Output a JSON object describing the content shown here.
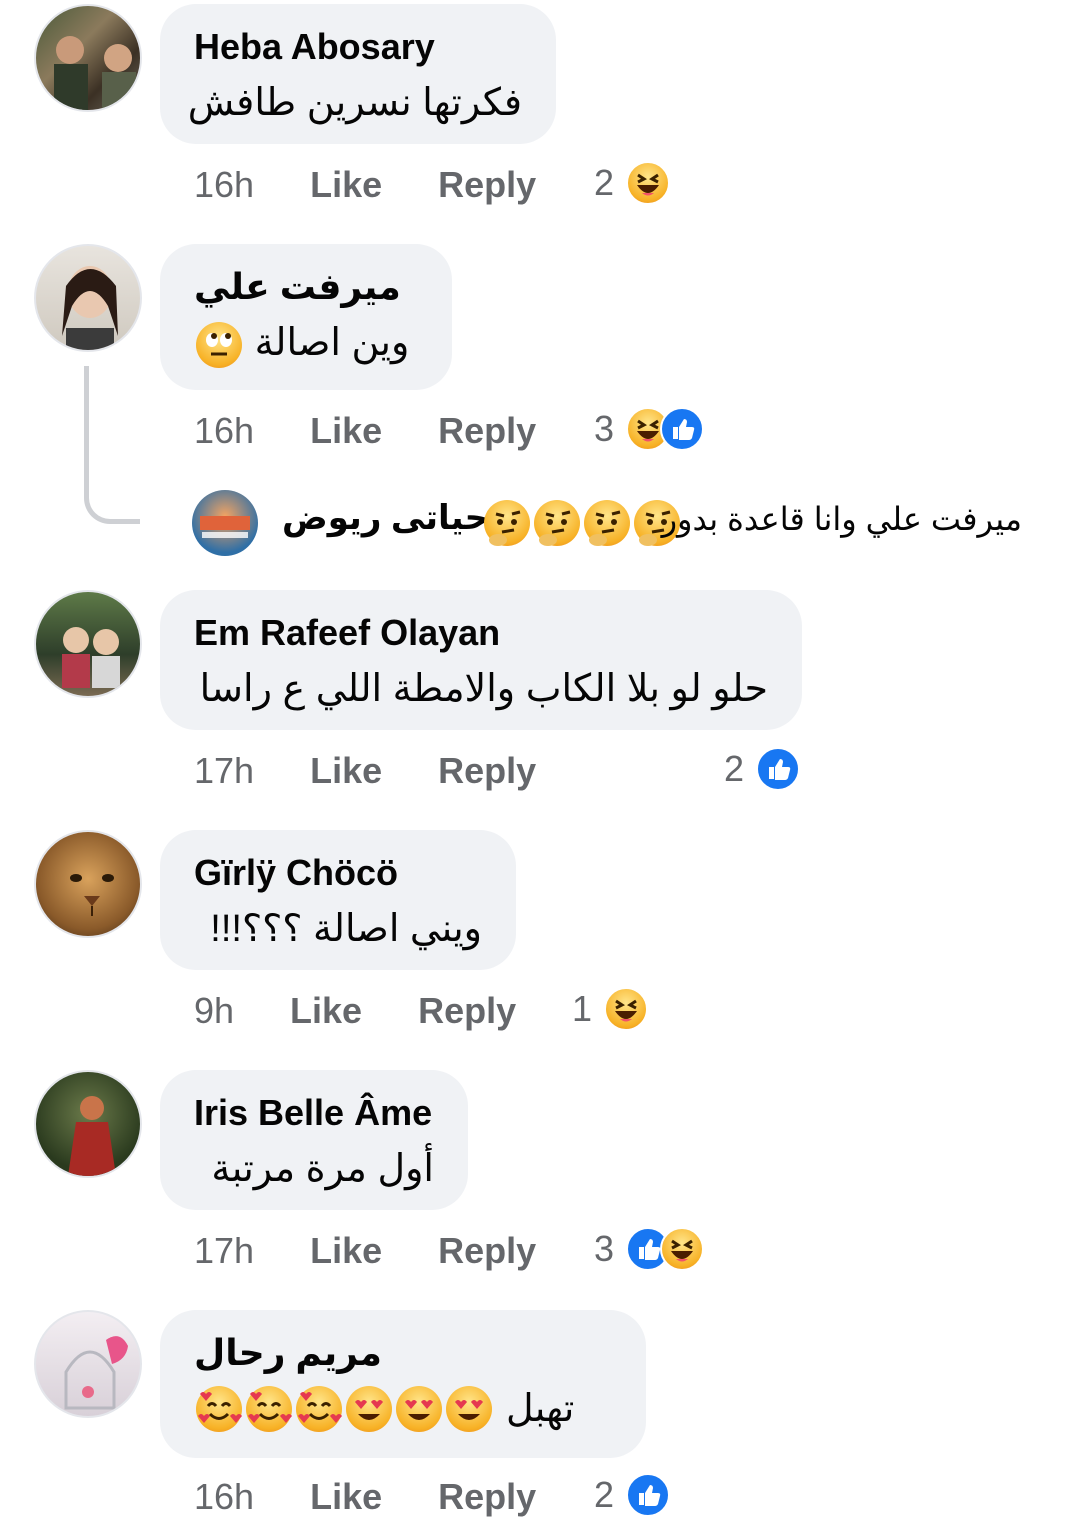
{
  "labels": {
    "like": "Like",
    "reply": "Reply"
  },
  "comments": [
    {
      "author": "Heba Abosary",
      "text": "فكرتها نسرين طافش",
      "time": "16h",
      "reaction_count": "2",
      "reactions": [
        "haha-icon"
      ]
    },
    {
      "author": "ميرفت علي",
      "text": "وين اصالة",
      "text_emoji": "rolling-eyes-emoji",
      "time": "16h",
      "reaction_count": "3",
      "reactions": [
        "haha-icon",
        "like-icon"
      ],
      "reply_preview": {
        "author": "حياتى ريوض",
        "text": "ميرفت علي وانا قاعدة بدور",
        "emoji": [
          "thinking-emoji",
          "thinking-emoji",
          "thinking-emoji",
          "thinking-emoji"
        ]
      }
    },
    {
      "author": "Em Rafeef Olayan",
      "text": "حلو لو بلا الكاب والامطة اللي ع راسا",
      "time": "17h",
      "reaction_count": "2",
      "reactions": [
        "like-icon"
      ]
    },
    {
      "author": "Gïrlÿ Chöcö",
      "text": "ويني اصالة ؟؟؟!!!",
      "time": "9h",
      "reaction_count": "1",
      "reactions": [
        "haha-icon"
      ]
    },
    {
      "author": "Iris Belle Âme",
      "text": "أول مرة مرتبة",
      "time": "17h",
      "reaction_count": "3",
      "reactions": [
        "like-icon",
        "haha-icon"
      ]
    },
    {
      "author": "مريم رحال",
      "text": "تهبل",
      "text_emoji": [
        "heart-eyes-emoji",
        "heart-eyes-emoji",
        "heart-eyes-emoji",
        "smiling-hearts-emoji",
        "smiling-hearts-emoji",
        "smiling-hearts-emoji"
      ],
      "time": "16h",
      "reaction_count": "2",
      "reactions": [
        "like-icon"
      ]
    }
  ],
  "colors": {
    "bubble": "#f0f2f5",
    "meta": "#65676b",
    "like_blue": "#1877f2",
    "haha_yellow": "#f7b125"
  }
}
